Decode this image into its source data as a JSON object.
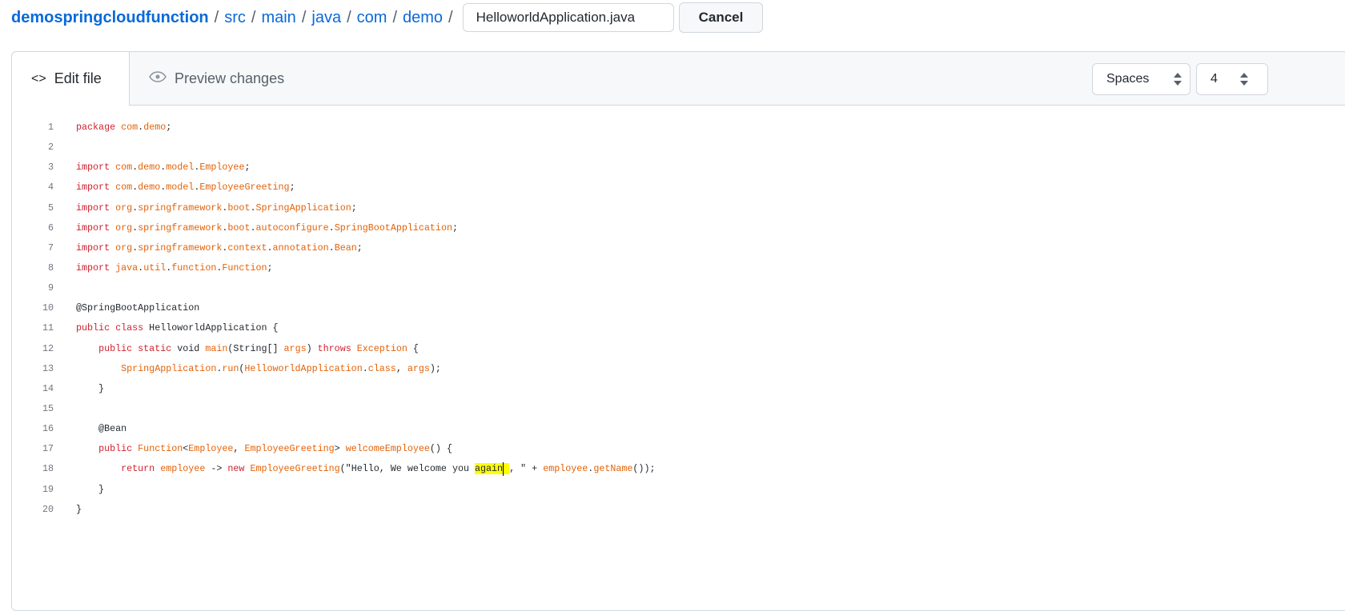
{
  "breadcrumb": {
    "repo": "demospringcloudfunction",
    "path": [
      "src",
      "main",
      "java",
      "com",
      "demo"
    ],
    "separator": "/"
  },
  "filename": "HelloworldApplication.java",
  "cancel_label": "Cancel",
  "tabs": {
    "edit": "Edit file",
    "preview": "Preview changes"
  },
  "indent_mode": "Spaces",
  "indent_size": "4",
  "colors": {
    "keyword": "#cf222e",
    "identifier": "#e36209",
    "highlight": "#ffff00",
    "link": "#0969da"
  },
  "code": [
    [
      [
        "k",
        "package"
      ],
      [
        "p",
        " "
      ],
      [
        "o",
        "com"
      ],
      [
        "p",
        "."
      ],
      [
        "o",
        "demo"
      ],
      [
        "p",
        ";"
      ]
    ],
    [],
    [
      [
        "k",
        "import"
      ],
      [
        "p",
        " "
      ],
      [
        "o",
        "com"
      ],
      [
        "p",
        "."
      ],
      [
        "o",
        "demo"
      ],
      [
        "p",
        "."
      ],
      [
        "o",
        "model"
      ],
      [
        "p",
        "."
      ],
      [
        "o",
        "Employee"
      ],
      [
        "p",
        ";"
      ]
    ],
    [
      [
        "k",
        "import"
      ],
      [
        "p",
        " "
      ],
      [
        "o",
        "com"
      ],
      [
        "p",
        "."
      ],
      [
        "o",
        "demo"
      ],
      [
        "p",
        "."
      ],
      [
        "o",
        "model"
      ],
      [
        "p",
        "."
      ],
      [
        "o",
        "EmployeeGreeting"
      ],
      [
        "p",
        ";"
      ]
    ],
    [
      [
        "k",
        "import"
      ],
      [
        "p",
        " "
      ],
      [
        "o",
        "org"
      ],
      [
        "p",
        "."
      ],
      [
        "o",
        "springframework"
      ],
      [
        "p",
        "."
      ],
      [
        "o",
        "boot"
      ],
      [
        "p",
        "."
      ],
      [
        "o",
        "SpringApplication"
      ],
      [
        "p",
        ";"
      ]
    ],
    [
      [
        "k",
        "import"
      ],
      [
        "p",
        " "
      ],
      [
        "o",
        "org"
      ],
      [
        "p",
        "."
      ],
      [
        "o",
        "springframework"
      ],
      [
        "p",
        "."
      ],
      [
        "o",
        "boot"
      ],
      [
        "p",
        "."
      ],
      [
        "o",
        "autoconfigure"
      ],
      [
        "p",
        "."
      ],
      [
        "o",
        "SpringBootApplication"
      ],
      [
        "p",
        ";"
      ]
    ],
    [
      [
        "k",
        "import"
      ],
      [
        "p",
        " "
      ],
      [
        "o",
        "org"
      ],
      [
        "p",
        "."
      ],
      [
        "o",
        "springframework"
      ],
      [
        "p",
        "."
      ],
      [
        "o",
        "context"
      ],
      [
        "p",
        "."
      ],
      [
        "o",
        "annotation"
      ],
      [
        "p",
        "."
      ],
      [
        "o",
        "Bean"
      ],
      [
        "p",
        ";"
      ]
    ],
    [
      [
        "k",
        "import"
      ],
      [
        "p",
        " "
      ],
      [
        "o",
        "java"
      ],
      [
        "p",
        "."
      ],
      [
        "o",
        "util"
      ],
      [
        "p",
        "."
      ],
      [
        "o",
        "function"
      ],
      [
        "p",
        "."
      ],
      [
        "o",
        "Function"
      ],
      [
        "p",
        ";"
      ]
    ],
    [],
    [
      [
        "p",
        "@SpringBootApplication"
      ]
    ],
    [
      [
        "k",
        "public class"
      ],
      [
        "p",
        " HelloworldApplication {"
      ]
    ],
    [
      [
        "p",
        "    "
      ],
      [
        "k",
        "public static"
      ],
      [
        "p",
        " void "
      ],
      [
        "o",
        "main"
      ],
      [
        "p",
        "(String[] "
      ],
      [
        "o",
        "args"
      ],
      [
        "p",
        ") "
      ],
      [
        "k",
        "throws"
      ],
      [
        "p",
        " "
      ],
      [
        "o",
        "Exception"
      ],
      [
        "p",
        " {"
      ]
    ],
    [
      [
        "p",
        "        "
      ],
      [
        "o",
        "SpringApplication"
      ],
      [
        "p",
        "."
      ],
      [
        "o",
        "run"
      ],
      [
        "p",
        "("
      ],
      [
        "o",
        "HelloworldApplication"
      ],
      [
        "p",
        "."
      ],
      [
        "o",
        "class"
      ],
      [
        "p",
        ", "
      ],
      [
        "o",
        "args"
      ],
      [
        "p",
        ");"
      ]
    ],
    [
      [
        "p",
        "    }"
      ]
    ],
    [],
    [
      [
        "p",
        "    @Bean"
      ]
    ],
    [
      [
        "p",
        "    "
      ],
      [
        "k",
        "public"
      ],
      [
        "p",
        " "
      ],
      [
        "o",
        "Function"
      ],
      [
        "p",
        "<"
      ],
      [
        "o",
        "Employee"
      ],
      [
        "p",
        ", "
      ],
      [
        "o",
        "EmployeeGreeting"
      ],
      [
        "p",
        "> "
      ],
      [
        "o",
        "welcomeEmployee"
      ],
      [
        "p",
        "() {"
      ]
    ],
    [
      [
        "p",
        "        "
      ],
      [
        "k",
        "return"
      ],
      [
        "p",
        " "
      ],
      [
        "o",
        "employee"
      ],
      [
        "p",
        " -> "
      ],
      [
        "k",
        "new"
      ],
      [
        "p",
        " "
      ],
      [
        "o",
        "EmployeeGreeting"
      ],
      [
        "p",
        "(\"Hello, We welcome you "
      ],
      [
        "h",
        "again"
      ],
      [
        "c",
        ""
      ],
      [
        "h",
        " "
      ],
      [
        "p",
        ", \" + "
      ],
      [
        "o",
        "employee"
      ],
      [
        "p",
        "."
      ],
      [
        "o",
        "getName"
      ],
      [
        "p",
        "());"
      ]
    ],
    [
      [
        "p",
        "    }"
      ]
    ],
    [
      [
        "p",
        "}"
      ]
    ]
  ]
}
